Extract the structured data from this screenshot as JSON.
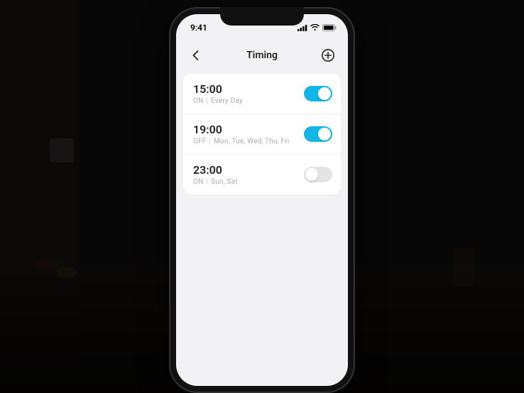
{
  "status_bar": {
    "time": "9:41"
  },
  "nav": {
    "title": "Timing"
  },
  "schedules": [
    {
      "time": "15:00",
      "action": "ON",
      "days": "Every Day",
      "enabled": true
    },
    {
      "time": "19:00",
      "action": "OFF",
      "days": "Mon, Tue, Wed, Thu, Fri",
      "enabled": true
    },
    {
      "time": "23:00",
      "action": "ON",
      "days": "Sun, Sat",
      "enabled": false
    }
  ],
  "colors": {
    "accent": "#12b5e5"
  }
}
